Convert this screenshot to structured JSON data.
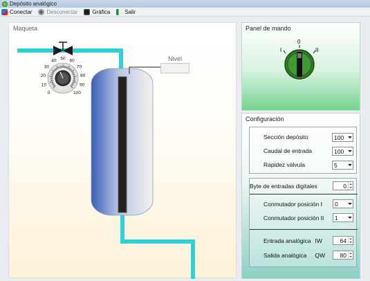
{
  "window": {
    "title": "Depósito analógico"
  },
  "toolbar": {
    "connect": "Conectar",
    "disconnect": "Desconectar",
    "chart": "Gráfica",
    "exit": "Salir"
  },
  "maqueta": {
    "label": "Maqueta",
    "nivel_label": "Nivel",
    "dial_ticks": [
      "0",
      "10",
      "20",
      "30",
      "40",
      "50",
      "60",
      "70",
      "80",
      "90",
      "100"
    ]
  },
  "panel_mando": {
    "label": "Panel de mando",
    "positions": [
      "I",
      "0",
      "II"
    ]
  },
  "config": {
    "label": "Configuración",
    "seccion_label": "Sección depósito",
    "seccion_value": "100",
    "caudal_label": "Caudal de entrada",
    "caudal_value": "100",
    "rapidez_label": "Rapidez válvula",
    "rapidez_value": "5",
    "byte_label": "Byte de entradas digitales",
    "byte_value": "0",
    "conm1_label": "Conmutador posición I",
    "conm1_value": "0",
    "conm2_label": "Conmutador posición II",
    "conm2_value": "1",
    "entrada_label": "Entrada analógica",
    "entrada_tag": "IW",
    "entrada_value": "64",
    "salida_label": "Salida analógica",
    "salida_tag": "QW",
    "salida_value": "80"
  },
  "colors": {
    "pipe": "#2fd0d8",
    "tank_left": "#3a5fb8",
    "tank_right": "#f2f2ee",
    "switch_green": "#2e7d24"
  }
}
